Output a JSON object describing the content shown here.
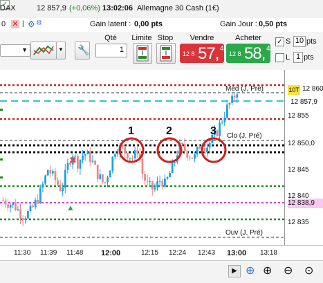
{
  "header": {
    "product_prefix": "DAX",
    "price": "12 857,9",
    "change": "(+0,06%)",
    "time": "13:02:06",
    "instrument": "Allemagne 30 Cash (1€)"
  },
  "gains": {
    "left_value": "0",
    "latent_label": "Gain latent :",
    "latent_value": "0,00 pts",
    "day_label": "Gain Jour :",
    "day_value": "0,50 pts"
  },
  "order": {
    "qty_label": "Qté",
    "qty_value": "1",
    "limit_label": "Limite",
    "stop_label": "Stop",
    "sell_label": "Vendre",
    "buy_label": "Acheter",
    "sell_prefix": "12 8",
    "sell_main": "57,",
    "sell_sup": "4",
    "buy_prefix": "12 8",
    "buy_main": "58,",
    "buy_sup": "4",
    "s_label": "S",
    "s_value": "10",
    "s_unit": "pts",
    "l_label": "L",
    "l_value": "1",
    "l_unit": "pts",
    "colors": {
      "sell": "#d9343a",
      "buy": "#2aa84a"
    }
  },
  "chart": {
    "y_ticks": [
      "12 855",
      "12 850,0",
      "12 845",
      "12 840",
      "12 835"
    ],
    "x_ticks": [
      "11:30",
      "11:39",
      "11:48",
      "12:00",
      "12:15",
      "12:24",
      "12:43",
      "13:00",
      "13:18"
    ],
    "x_bold": [
      "12:00",
      "13:00"
    ],
    "tag_10t": "10T",
    "price_tag_high": "12 860",
    "price_tag_current": "12 857,9",
    "price_tag_pink": "12 838,9",
    "level_med": "Méd (J, Pré)",
    "level_clo": "Clo (J, Pré)",
    "level_ouv": "Ouv (J, Pré)",
    "markers": [
      "1",
      "2",
      "3"
    ],
    "colors": {
      "up": "#1ea0e6",
      "down": "#e58a8a",
      "red_dotted": "#d21e1e",
      "green_dotted": "#1f8a1f",
      "magenta_dotted": "#d43bd4",
      "cyan_dashed": "#2ec7c7",
      "black_dotted": "#111111",
      "circle": "#d21e1e"
    }
  },
  "toolbar_bottom": {
    "icons": [
      "scroll-right-icon",
      "crosshair-icon",
      "zoom-in-icon",
      "zoom-out-icon",
      "zoom-fit-icon"
    ]
  }
}
